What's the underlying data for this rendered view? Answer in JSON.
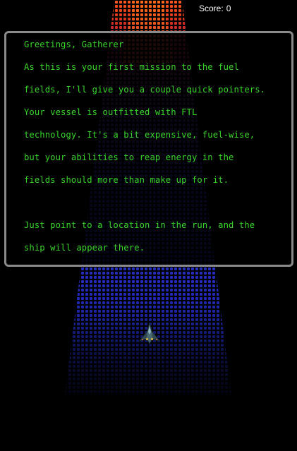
{
  "hud": {
    "score_label": "Score:",
    "score_value": "0"
  },
  "dialog": {
    "lines": [
      "Greetings, Gatherer",
      "As this is your first mission to the fuel",
      "fields, I'll give you a couple quick pointers.",
      "Your vessel is outfitted with FTL",
      "technology. It's a bit expensive, fuel-wise,",
      "but your abilities to reap energy in the",
      "fields should more than make up for it.",
      "",
      "Just point to a location in the run, and the",
      "ship will appear there."
    ]
  },
  "colors": {
    "background": "#000000",
    "dialog_text": "#39d62a",
    "dialog_border": "#8a8a8a",
    "score_text": "#ffffff",
    "run_top": "#e8401a",
    "run_bottom": "#2a3cff"
  },
  "icons": {
    "player": "spaceship-icon"
  }
}
